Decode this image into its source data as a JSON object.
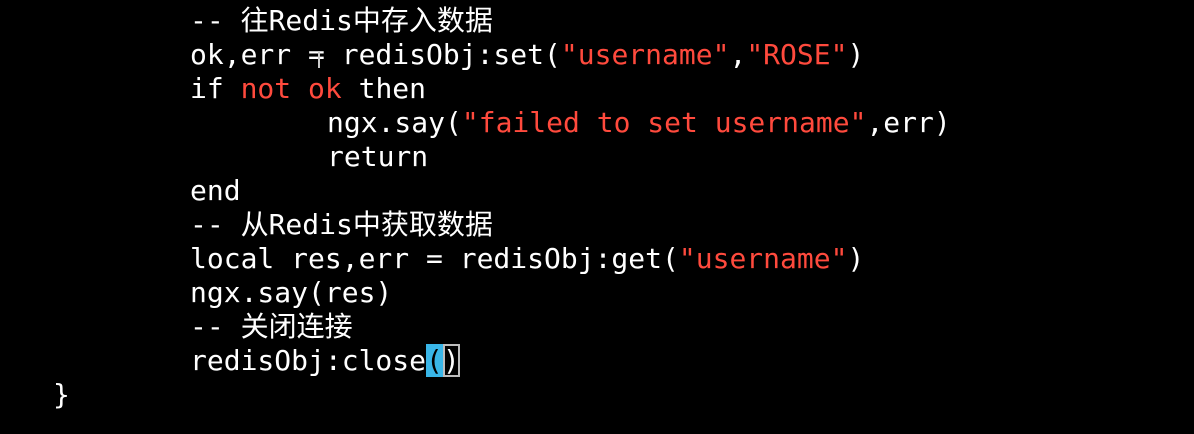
{
  "editor": {
    "lines": [
      {
        "indent": 2,
        "tokens": [
          {
            "t": "-- 往Redis中存入数据",
            "c": "comment"
          }
        ]
      },
      {
        "indent": 2,
        "tokens": [
          {
            "t": "ok,err = redisObj:set(",
            "c": "plain"
          },
          {
            "t": "\"username\"",
            "c": "str"
          },
          {
            "t": ",",
            "c": "plain"
          },
          {
            "t": "\"ROSE\"",
            "c": "str"
          },
          {
            "t": ")",
            "c": "plain"
          }
        ]
      },
      {
        "indent": 2,
        "tokens": [
          {
            "t": "if ",
            "c": "plain"
          },
          {
            "t": "not ok",
            "c": "kw"
          },
          {
            "t": " then",
            "c": "plain"
          }
        ]
      },
      {
        "indent": 3,
        "tokens": [
          {
            "t": "ngx.say(",
            "c": "plain"
          },
          {
            "t": "\"failed to set username\"",
            "c": "str"
          },
          {
            "t": ",err)",
            "c": "plain"
          }
        ]
      },
      {
        "indent": 3,
        "tokens": [
          {
            "t": "return",
            "c": "plain"
          }
        ]
      },
      {
        "indent": 2,
        "tokens": [
          {
            "t": "end",
            "c": "plain"
          }
        ]
      },
      {
        "indent": 2,
        "tokens": [
          {
            "t": "-- 从Redis中获取数据",
            "c": "comment"
          }
        ]
      },
      {
        "indent": 2,
        "tokens": [
          {
            "t": "local res,err = redisObj:get(",
            "c": "plain"
          },
          {
            "t": "\"username\"",
            "c": "str"
          },
          {
            "t": ")",
            "c": "plain"
          }
        ]
      },
      {
        "indent": 2,
        "tokens": [
          {
            "t": "ngx.say(res)",
            "c": "plain"
          }
        ]
      },
      {
        "indent": 2,
        "tokens": [
          {
            "t": "-- 关闭连接",
            "c": "comment"
          }
        ]
      },
      {
        "indent": 2,
        "tokens": [
          {
            "t": "redisObj:close",
            "c": "plain"
          },
          {
            "t": "(",
            "c": "cursor"
          },
          {
            "t": ")",
            "c": "match"
          }
        ]
      },
      {
        "indent": 1,
        "tokens": [
          {
            "t": "}",
            "c": "plain"
          }
        ]
      }
    ]
  },
  "colors": {
    "background": "#000000",
    "text": "#ffffff",
    "keyword": "#ff4a3d",
    "string": "#ff4a3d",
    "cursor": "#39b6e8"
  }
}
